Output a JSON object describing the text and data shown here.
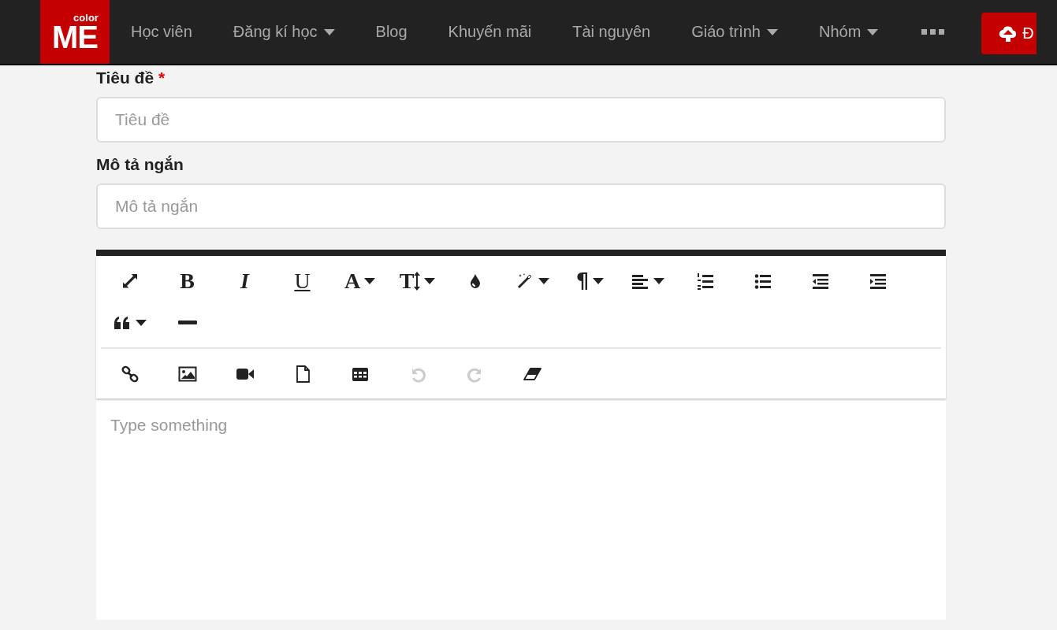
{
  "navbar": {
    "logo": {
      "small": "color",
      "big": "ME"
    },
    "items": [
      {
        "label": "Học viên",
        "dropdown": false
      },
      {
        "label": "Đăng kí học",
        "dropdown": true
      },
      {
        "label": "Blog",
        "dropdown": false
      },
      {
        "label": "Khuyến mãi",
        "dropdown": false
      },
      {
        "label": "Tài nguyên",
        "dropdown": false
      },
      {
        "label": "Giáo trình",
        "dropdown": true
      },
      {
        "label": "Nhóm",
        "dropdown": true
      }
    ],
    "upload_button": {
      "label": "Đ"
    }
  },
  "form": {
    "fields": [
      {
        "label": "Tiêu đề",
        "required_mark": "*",
        "placeholder": "Tiêu đề"
      },
      {
        "label": "Mô tả ngắn",
        "placeholder": "Mô tả ngắn"
      }
    ]
  },
  "editor": {
    "toolbar": [
      [
        {
          "kind": "fullscreen",
          "dropdown": false,
          "disabled": false
        },
        {
          "kind": "bold",
          "glyph": "B",
          "dropdown": false,
          "disabled": false
        },
        {
          "kind": "italic",
          "glyph": "I",
          "dropdown": false,
          "disabled": false
        },
        {
          "kind": "underline",
          "glyph": "U",
          "dropdown": false,
          "disabled": false
        },
        {
          "kind": "font",
          "glyph": "A",
          "dropdown": true,
          "disabled": false
        },
        {
          "kind": "fontsize",
          "glyph": "T",
          "dropdown": true,
          "disabled": false
        },
        {
          "kind": "color",
          "dropdown": false,
          "disabled": false
        },
        {
          "kind": "style",
          "dropdown": true,
          "disabled": false
        },
        {
          "kind": "paragraph",
          "glyph": "¶",
          "dropdown": true,
          "disabled": false
        },
        {
          "kind": "align",
          "dropdown": true,
          "disabled": false
        },
        {
          "kind": "ol",
          "dropdown": false,
          "disabled": false
        },
        {
          "kind": "ul",
          "dropdown": false,
          "disabled": false
        },
        {
          "kind": "outdent",
          "dropdown": false,
          "disabled": false
        },
        {
          "kind": "indent",
          "dropdown": false,
          "disabled": false
        },
        {
          "kind": "quote",
          "dropdown": true,
          "disabled": false
        },
        {
          "kind": "hr",
          "dropdown": false,
          "disabled": false
        }
      ],
      [
        {
          "kind": "link",
          "dropdown": false,
          "disabled": false
        },
        {
          "kind": "image",
          "dropdown": false,
          "disabled": false
        },
        {
          "kind": "video",
          "dropdown": false,
          "disabled": false
        },
        {
          "kind": "file",
          "dropdown": false,
          "disabled": false
        },
        {
          "kind": "table",
          "dropdown": false,
          "disabled": false
        },
        {
          "kind": "undo",
          "dropdown": false,
          "disabled": true
        },
        {
          "kind": "redo",
          "dropdown": false,
          "disabled": true
        },
        {
          "kind": "eraser",
          "dropdown": false,
          "disabled": false
        }
      ]
    ],
    "placeholder": "Type something"
  }
}
